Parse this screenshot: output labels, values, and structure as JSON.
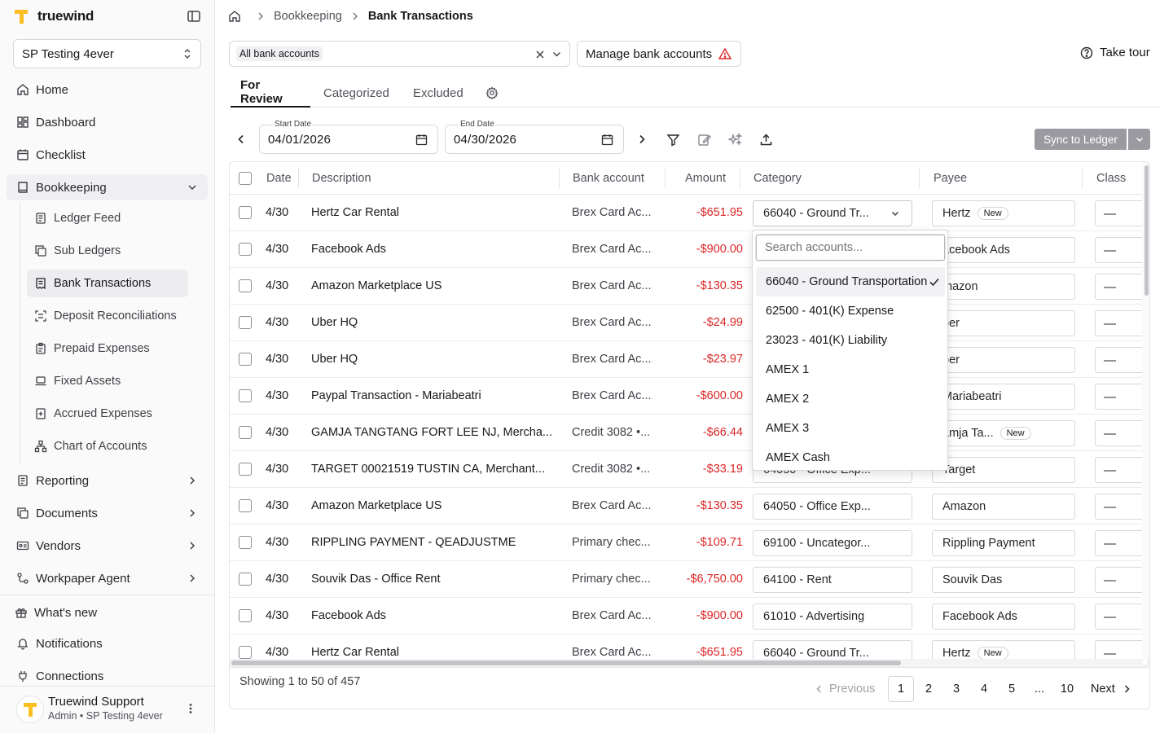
{
  "app": {
    "brand": "truewind"
  },
  "org": {
    "name": "SP Testing 4ever"
  },
  "nav": {
    "home": "Home",
    "dashboard": "Dashboard",
    "checklist": "Checklist",
    "bookkeeping": "Bookkeeping",
    "sub": [
      "Ledger Feed",
      "Sub Ledgers",
      "Bank Transactions",
      "Deposit Reconciliations",
      "Prepaid Expenses",
      "Fixed Assets",
      "Accrued Expenses",
      "Chart of Accounts"
    ],
    "reporting": "Reporting",
    "documents": "Documents",
    "vendors": "Vendors",
    "workpaper": "Workpaper Agent",
    "whats_new": "What's new",
    "notifications": "Notifications",
    "connections": "Connections"
  },
  "user": {
    "name": "Truewind Support",
    "sub": "Admin • SP Testing 4ever"
  },
  "breadcrumb": {
    "parent": "Bookkeeping",
    "current": "Bank Transactions"
  },
  "toolbar": {
    "accounts_chip": "All bank accounts",
    "manage_label": "Manage bank accounts",
    "tour_label": "Take tour",
    "start_label": "Start Date",
    "start_value": "04/01/2026",
    "end_label": "End Date",
    "end_value": "04/30/2026",
    "sync_label": "Sync to Ledger"
  },
  "tabs": [
    "For Review",
    "Categorized",
    "Excluded"
  ],
  "table": {
    "headers": [
      "Date",
      "Description",
      "Bank account",
      "Amount",
      "Category",
      "Payee",
      "Class"
    ],
    "rows": [
      {
        "date": "4/30",
        "desc": "Hertz Car Rental",
        "bank": "Brex Card Ac...",
        "amount": "-$651.95",
        "category": "66040 - Ground Tr...",
        "payee": "Hertz",
        "badge": "New",
        "class": "—"
      },
      {
        "date": "4/30",
        "desc": "Facebook Ads",
        "bank": "Brex Card Ac...",
        "amount": "-$900.00",
        "category": "",
        "payee": "acebook Ads",
        "badge": "",
        "class": "—"
      },
      {
        "date": "4/30",
        "desc": "Amazon Marketplace US",
        "bank": "Brex Card Ac...",
        "amount": "-$130.35",
        "category": "",
        "payee": "mazon",
        "badge": "",
        "class": "—"
      },
      {
        "date": "4/30",
        "desc": "Uber HQ",
        "bank": "Brex Card Ac...",
        "amount": "-$24.99",
        "category": "",
        "payee": "ber",
        "badge": "",
        "class": "—"
      },
      {
        "date": "4/30",
        "desc": "Uber HQ",
        "bank": "Brex Card Ac...",
        "amount": "-$23.97",
        "category": "",
        "payee": "ber",
        "badge": "",
        "class": "—"
      },
      {
        "date": "4/30",
        "desc": "Paypal Transaction - Mariabeatri",
        "bank": "Brex Card Ac...",
        "amount": "-$600.00",
        "category": "",
        "payee": "Mariabeatri",
        "badge": "",
        "class": "—"
      },
      {
        "date": "4/30",
        "desc": "GAMJA TANGTANG FORT LEE NJ, Mercha...",
        "bank": "Credit 3082 •...",
        "amount": "-$66.44",
        "category": "",
        "payee": "amja Ta...",
        "badge": "New",
        "class": "—"
      },
      {
        "date": "4/30",
        "desc": "TARGET 00021519 TUSTIN CA, Merchant...",
        "bank": "Credit 3082 •...",
        "amount": "-$33.19",
        "category": "64050 - Office Exp...",
        "payee": "Target",
        "badge": "",
        "class": "—"
      },
      {
        "date": "4/30",
        "desc": "Amazon Marketplace US",
        "bank": "Brex Card Ac...",
        "amount": "-$130.35",
        "category": "64050 - Office Exp...",
        "payee": "Amazon",
        "badge": "",
        "class": "—"
      },
      {
        "date": "4/30",
        "desc": "RIPPLING PAYMENT - QEADJUSTME",
        "bank": "Primary chec...",
        "amount": "-$109.71",
        "category": "69100 - Uncategor...",
        "payee": "Rippling Payment",
        "badge": "",
        "class": "—"
      },
      {
        "date": "4/30",
        "desc": "Souvik Das - Office Rent",
        "bank": "Primary chec...",
        "amount": "-$6,750.00",
        "category": "64100 - Rent",
        "payee": "Souvik Das",
        "badge": "",
        "class": "—"
      },
      {
        "date": "4/30",
        "desc": "Facebook Ads",
        "bank": "Brex Card Ac...",
        "amount": "-$900.00",
        "category": "61010 - Advertising",
        "payee": "Facebook Ads",
        "badge": "",
        "class": "—"
      },
      {
        "date": "4/30",
        "desc": "Hertz Car Rental",
        "bank": "Brex Card Ac...",
        "amount": "-$651.95",
        "category": "66040 - Ground Tr...",
        "payee": "Hertz",
        "badge": "New",
        "class": "—"
      }
    ]
  },
  "dropdown": {
    "placeholder": "Search accounts...",
    "options": [
      "66040 - Ground Transportation",
      "62500 - 401(K) Expense",
      "23023 - 401(K) Liability",
      "AMEX 1",
      "AMEX 2",
      "AMEX 3",
      "AMEX Cash"
    ]
  },
  "pagination": {
    "showing": "Showing 1 to 50 of 457",
    "previous": "Previous",
    "pages": [
      "1",
      "2",
      "3",
      "4",
      "5"
    ],
    "ellipsis": "...",
    "last": "10",
    "next": "Next"
  },
  "colors": {
    "negative_amount": "#dc2626",
    "brand_logo": "#fbbf24",
    "sync_button": "#9a9aa0"
  }
}
